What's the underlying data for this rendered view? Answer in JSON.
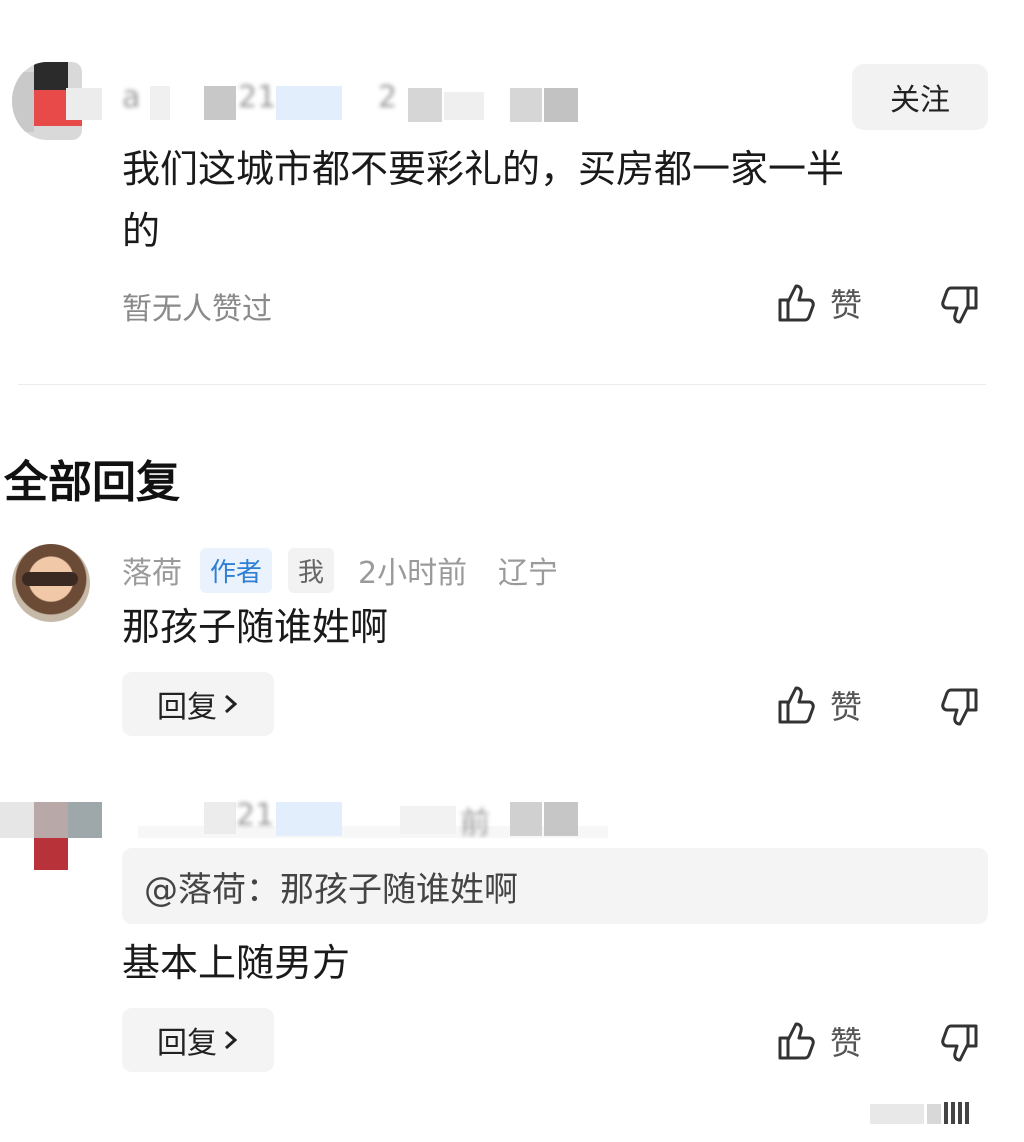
{
  "top_comment": {
    "username": "a",
    "meta_fragment_1": "21",
    "meta_fragment_2": "2",
    "follow_label": "关注",
    "text_line1": "我们这城市都不要彩礼的，买房都一家一半",
    "text_line2": "的",
    "no_likes": "暂无人赞过",
    "like_label": "赞"
  },
  "section_title": "全部回复",
  "reply1": {
    "username": "落荷",
    "author_badge": "作者",
    "me_badge": "我",
    "time": "2小时前",
    "location": "辽宁",
    "text": "那孩子随谁姓啊",
    "reply_label": "回复",
    "like_label": "赞"
  },
  "reply2": {
    "meta_fragment_1": "21",
    "meta_fragment_2": "前",
    "quote": "@落荷：那孩子随谁姓啊",
    "text": "基本上随男方",
    "reply_label": "回复",
    "like_label": "赞"
  },
  "colors": {
    "author_badge": "#2f7fd6",
    "muted_text": "#9a9a9a",
    "button_bg": "#f2f2f2"
  },
  "icons": [
    "thumb-up-icon",
    "thumb-down-icon",
    "chevron-right-icon"
  ]
}
